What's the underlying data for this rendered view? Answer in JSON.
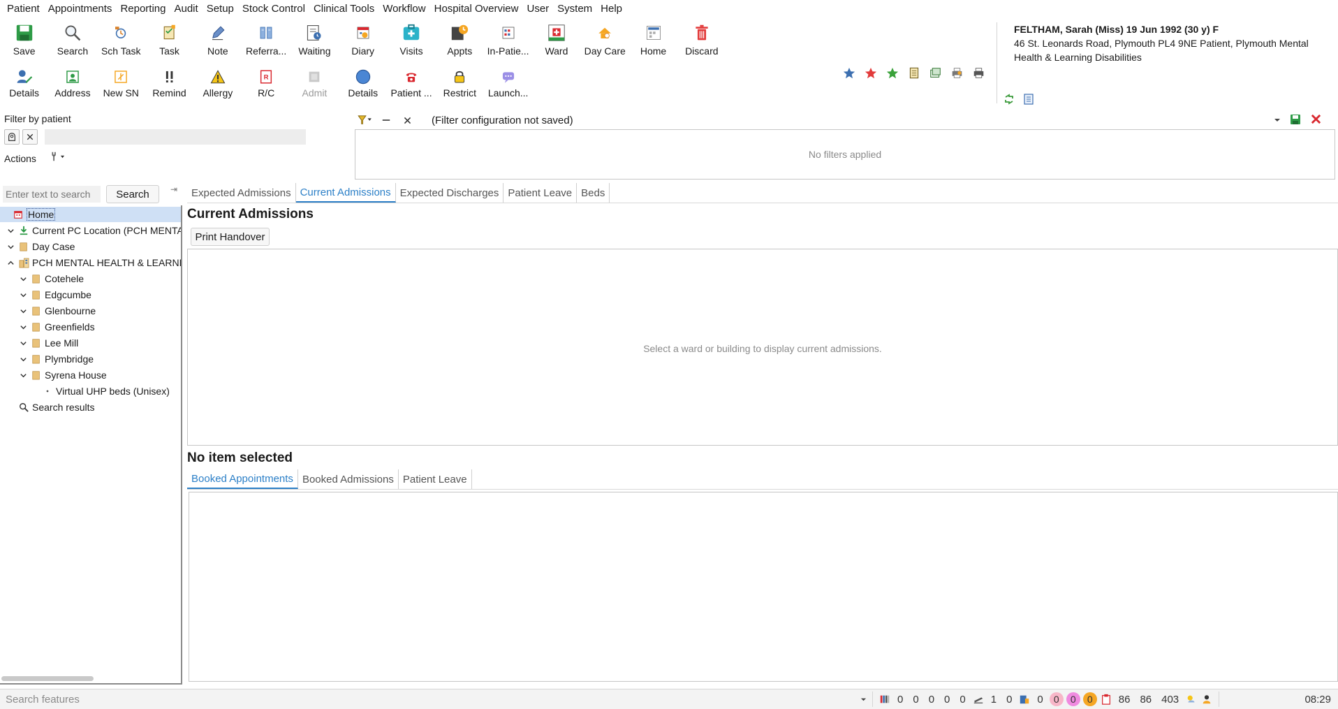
{
  "menu": [
    "Patient",
    "Appointments",
    "Reporting",
    "Audit",
    "Setup",
    "Stock Control",
    "Clinical Tools",
    "Workflow",
    "Hospital Overview",
    "User",
    "System",
    "Help"
  ],
  "toolbar_row1": [
    {
      "label": "Save",
      "icon": "save-icon"
    },
    {
      "label": "Search",
      "icon": "search-icon"
    },
    {
      "label": "Sch Task",
      "icon": "schedule-task-icon"
    },
    {
      "label": "Task",
      "icon": "task-icon"
    },
    {
      "label": "Note",
      "icon": "note-icon"
    },
    {
      "label": "Referra...",
      "icon": "referral-icon"
    },
    {
      "label": "Waiting",
      "icon": "waiting-list-icon"
    },
    {
      "label": "Diary",
      "icon": "diary-icon"
    },
    {
      "label": "Visits",
      "icon": "visits-icon"
    },
    {
      "label": "Appts",
      "icon": "appointments-icon"
    },
    {
      "label": "In-Patie...",
      "icon": "inpatient-icon"
    },
    {
      "label": "Ward",
      "icon": "ward-icon"
    },
    {
      "label": "Day Care",
      "icon": "day-care-icon"
    },
    {
      "label": "Home",
      "icon": "home-icon"
    },
    {
      "label": "Discard",
      "icon": "trash-icon"
    }
  ],
  "toolbar_row2": [
    {
      "label": "Details",
      "icon": "patient-details-icon"
    },
    {
      "label": "Address",
      "icon": "address-icon"
    },
    {
      "label": "New SN",
      "icon": "new-sn-icon"
    },
    {
      "label": "Remind",
      "icon": "reminder-icon"
    },
    {
      "label": "Allergy",
      "icon": "allergy-icon"
    },
    {
      "label": "R/C",
      "icon": "rc-icon"
    },
    {
      "label": "Admit",
      "icon": "admit-icon",
      "disabled": true
    },
    {
      "label": "Details",
      "icon": "details-circle-icon"
    },
    {
      "label": "Patient ...",
      "icon": "phone-icon"
    },
    {
      "label": "Restrict",
      "icon": "lock-icon"
    },
    {
      "label": "Launch...",
      "icon": "launch-icon"
    }
  ],
  "quick_icons": [
    "star-blue-icon",
    "star-red-icon",
    "star-green-icon",
    "document-icon",
    "forms-icon",
    "printer-multi-icon",
    "printer-icon"
  ],
  "patient": {
    "name": "FELTHAM, Sarah (Miss) 19 Jun 1992 (30 y) F",
    "address": "46 St. Leonards Road, Plymouth PL4 9NE  Patient, Plymouth Mental Health & Learning Disabilities"
  },
  "filter_by_patient": {
    "label": "Filter by patient",
    "actions_label": "Actions"
  },
  "filter_config": {
    "selected": "(Filter configuration not saved)",
    "empty_text": "No filters applied"
  },
  "left_search": {
    "placeholder": "Enter text to search",
    "button": "Search"
  },
  "tree": [
    {
      "label": "Home",
      "level": 0,
      "twisty": "",
      "icon": "home-icon",
      "selected": true
    },
    {
      "label": "Current PC Location (PCH MENTAL HEALTH & LEARNING",
      "level": 0,
      "twisty": "down",
      "icon": "download-arrow-icon"
    },
    {
      "label": "Day Case",
      "level": 0,
      "twisty": "down",
      "icon": "folder-icon"
    },
    {
      "label": "PCH MENTAL HEALTH & LEARNING DISABILITIES",
      "level": 0,
      "twisty": "up",
      "icon": "building-icon"
    },
    {
      "label": "Cotehele",
      "level": 1,
      "twisty": "down",
      "icon": "folder-icon"
    },
    {
      "label": "Edgcumbe",
      "level": 1,
      "twisty": "down",
      "icon": "folder-icon"
    },
    {
      "label": "Glenbourne",
      "level": 1,
      "twisty": "down",
      "icon": "folder-icon"
    },
    {
      "label": "Greenfields",
      "level": 1,
      "twisty": "down",
      "icon": "folder-icon"
    },
    {
      "label": "Lee Mill",
      "level": 1,
      "twisty": "down",
      "icon": "folder-icon"
    },
    {
      "label": "Plymbridge",
      "level": 1,
      "twisty": "down",
      "icon": "folder-icon"
    },
    {
      "label": "Syrena House",
      "level": 1,
      "twisty": "down",
      "icon": "folder-icon"
    },
    {
      "label": "Virtual UHP beds (Unisex)",
      "level": 2,
      "twisty": "",
      "icon": "bullet-icon"
    },
    {
      "label": "Search results",
      "level": 0,
      "twisty": "",
      "icon": "search-icon"
    }
  ],
  "main_tabs": [
    {
      "label": "Expected Admissions"
    },
    {
      "label": "Current Admissions",
      "active": true
    },
    {
      "label": "Expected Discharges"
    },
    {
      "label": "Patient Leave"
    },
    {
      "label": "Beds"
    }
  ],
  "current_admissions": {
    "title": "Current Admissions",
    "print_button": "Print Handover",
    "empty_text": "Select a ward or building to display current admissions."
  },
  "detail": {
    "title": "No item selected",
    "tabs": [
      {
        "label": "Booked Appointments",
        "active": true
      },
      {
        "label": "Booked Admissions"
      },
      {
        "label": "Patient Leave"
      }
    ]
  },
  "status_bar": {
    "search_placeholder": "Search features",
    "group1": [
      "0",
      "0",
      "0",
      "0",
      "0"
    ],
    "group2": [
      "1",
      "0"
    ],
    "group3": [
      "0"
    ],
    "badges": [
      {
        "value": "0",
        "color": "#f7b6c8"
      },
      {
        "value": "0",
        "color": "#f08ae0"
      },
      {
        "value": "0",
        "color": "#f5a623"
      }
    ],
    "group4": [
      "86",
      "86",
      "403"
    ],
    "time": "08:29"
  },
  "colors": {
    "accent": "#2b7fc7",
    "selection": "#cfe0f5"
  }
}
